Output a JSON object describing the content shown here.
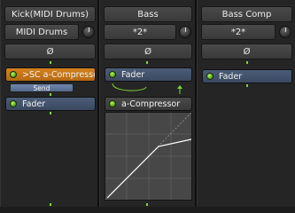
{
  "strips": [
    {
      "name": "Kick(MIDI Drums)",
      "input": "MIDI Drums",
      "phase": "Ø",
      "plugins": [
        {
          "label": ">SC a-Compressor/In",
          "send_label": "Send"
        },
        {
          "label": "Fader"
        }
      ]
    },
    {
      "name": "Bass",
      "input": "*2*",
      "phase": "Ø",
      "plugins": [
        {
          "label": "Fader"
        },
        {
          "label": "a-Compressor"
        }
      ]
    },
    {
      "name": "Bass Comp",
      "input": "*2*",
      "phase": "Ø",
      "plugins": [
        {
          "label": "Fader"
        }
      ]
    }
  ],
  "colors": {
    "fader_plugin": "#4c5d78",
    "sidechain_plugin": "#d4811e",
    "active_led": "#7fd43a"
  }
}
